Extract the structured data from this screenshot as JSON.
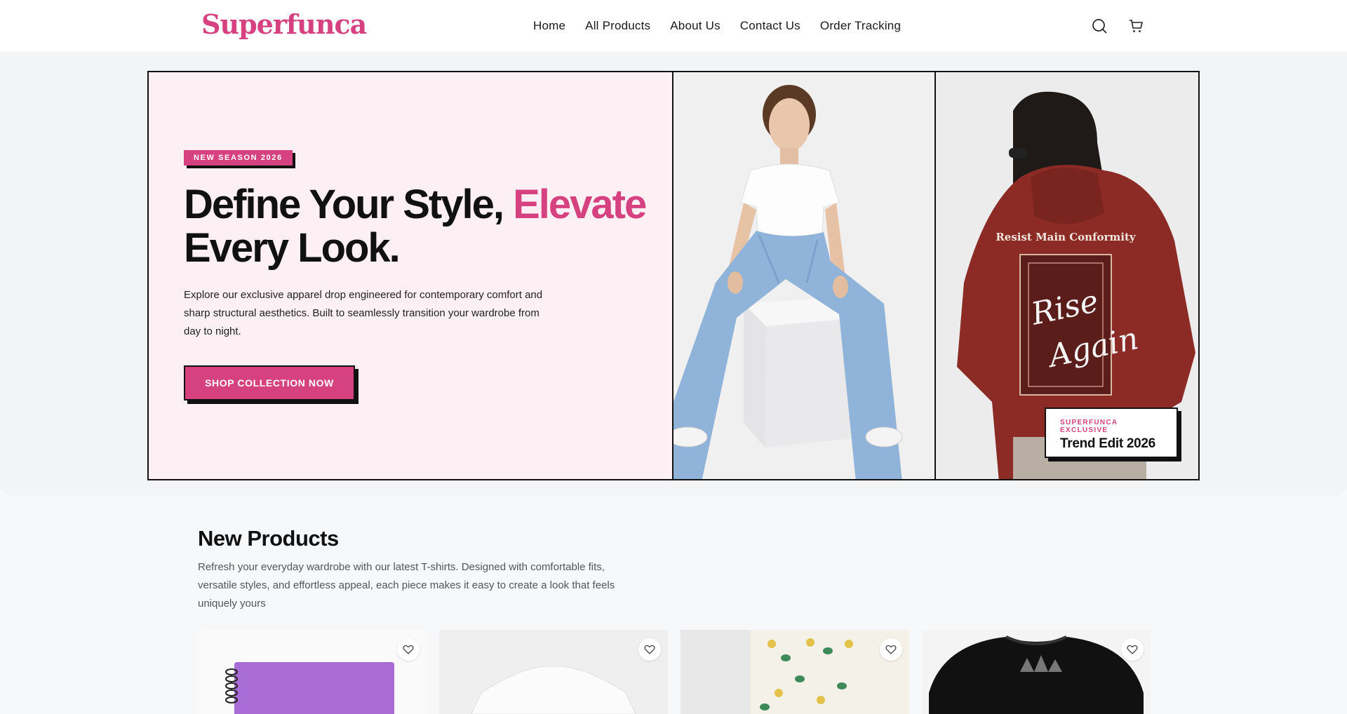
{
  "header": {
    "logo": "Superfunca",
    "nav": [
      "Home",
      "All Products",
      "About Us",
      "Contact Us",
      "Order Tracking"
    ],
    "icons": [
      "search-icon",
      "cart-icon"
    ]
  },
  "hero": {
    "badge": "NEW SEASON 2026",
    "headline_part1": "Define Your Style, ",
    "headline_accent": "Elevate",
    "headline_part2": "Every Look.",
    "description": "Explore our exclusive apparel drop engineered for contemporary comfort and sharp structural aesthetics. Built to seamlessly transition your wardrobe from day to night.",
    "cta": "SHOP COLLECTION NOW",
    "exclusive_label": "SUPERFUNCA EXCLUSIVE",
    "exclusive_title": "Trend Edit 2026",
    "hoodie_print_top": "Resist Main Conformity",
    "hoodie_print_script1": "Rise",
    "hoodie_print_script2": "Again"
  },
  "new_products": {
    "title": "New Products",
    "description": "Refresh your everyday wardrobe with our latest T-shirts. Designed with comfortable fits, versatile styles, and effortless appeal, each piece makes it easy to create a look that feels uniquely yours",
    "cards": [
      {
        "image": "purple-notebook"
      },
      {
        "image": "white-tshirt"
      },
      {
        "image": "floral-curtain"
      },
      {
        "image": "black-tshirt"
      }
    ]
  },
  "colors": {
    "brand_pink": "#d6417f",
    "hero_bg": "#fdf0f4",
    "ink": "#111111"
  }
}
